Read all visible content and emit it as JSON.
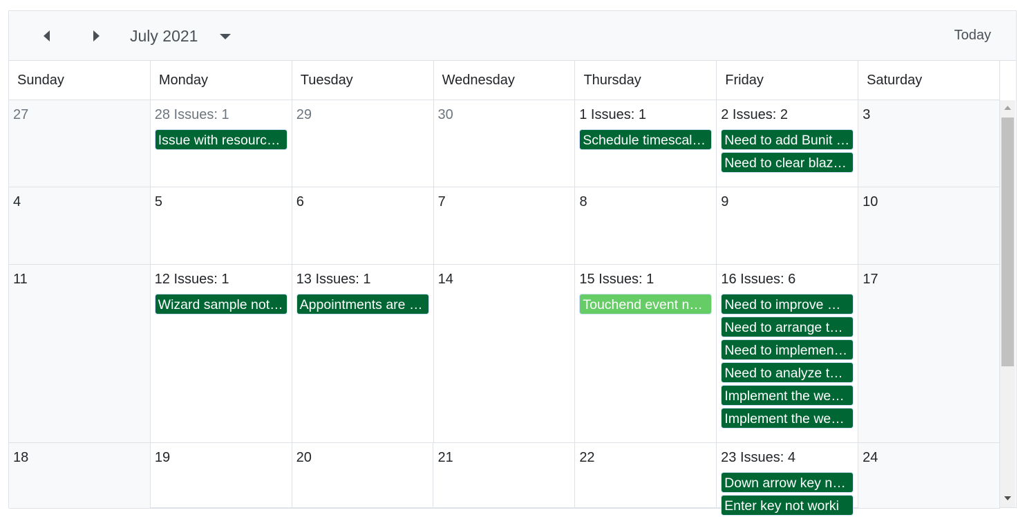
{
  "toolbar": {
    "title": "July 2021",
    "today_label": "Today",
    "prev_icon": "caret-left-icon",
    "next_icon": "caret-right-icon",
    "dropdown_icon": "caret-down-icon"
  },
  "colors": {
    "event": "#006633",
    "event_highlight": "#66cc66",
    "weekend_bg": "#f8f9fa",
    "border": "#dee2e6"
  },
  "weekdays": [
    "Sunday",
    "Monday",
    "Tuesday",
    "Wednesday",
    "Thursday",
    "Friday",
    "Saturday"
  ],
  "weeks": [
    {
      "days": [
        {
          "label": "27",
          "muted": true,
          "events": []
        },
        {
          "label": "28 Issues: 1",
          "muted": true,
          "events": [
            {
              "text": "Issue with resource…"
            }
          ]
        },
        {
          "label": "29",
          "muted": true,
          "events": []
        },
        {
          "label": "30",
          "muted": true,
          "events": []
        },
        {
          "label": "1 Issues: 1",
          "events": [
            {
              "text": "Schedule timescale…"
            }
          ]
        },
        {
          "label": "2 Issues: 2",
          "events": [
            {
              "text": "Need to add Bunit t…"
            },
            {
              "text": "Need to clear blazo…"
            }
          ]
        },
        {
          "label": "3",
          "events": []
        }
      ]
    },
    {
      "days": [
        {
          "label": "4",
          "events": []
        },
        {
          "label": "5",
          "events": []
        },
        {
          "label": "6",
          "events": []
        },
        {
          "label": "7",
          "events": []
        },
        {
          "label": "8",
          "events": []
        },
        {
          "label": "9",
          "events": []
        },
        {
          "label": "10",
          "events": []
        }
      ]
    },
    {
      "days": [
        {
          "label": "11",
          "events": []
        },
        {
          "label": "12 Issues: 1",
          "events": [
            {
              "text": "Wizard sample not …"
            }
          ]
        },
        {
          "label": "13 Issues: 1",
          "events": [
            {
              "text": "Appointments are n…"
            }
          ]
        },
        {
          "label": "14",
          "events": []
        },
        {
          "label": "15 Issues: 1",
          "events": [
            {
              "text": "Touchend event not…",
              "highlight": true
            }
          ]
        },
        {
          "label": "16 Issues: 6",
          "events": [
            {
              "text": "Need to improve w…"
            },
            {
              "text": "Need to arrange th…"
            },
            {
              "text": "Need to implement …"
            },
            {
              "text": "Need to analyze th…"
            },
            {
              "text": "Implement the web…"
            },
            {
              "text": "Implement the web…"
            }
          ]
        },
        {
          "label": "17",
          "events": []
        }
      ]
    },
    {
      "days": [
        {
          "label": "18",
          "events": []
        },
        {
          "label": "19",
          "events": []
        },
        {
          "label": "20",
          "events": []
        },
        {
          "label": "21",
          "events": []
        },
        {
          "label": "22",
          "events": []
        },
        {
          "label": "23 Issues: 4",
          "events": [
            {
              "text": "Down arrow key no…"
            },
            {
              "text": "Enter key not worki"
            }
          ]
        },
        {
          "label": "24",
          "events": []
        }
      ]
    }
  ]
}
